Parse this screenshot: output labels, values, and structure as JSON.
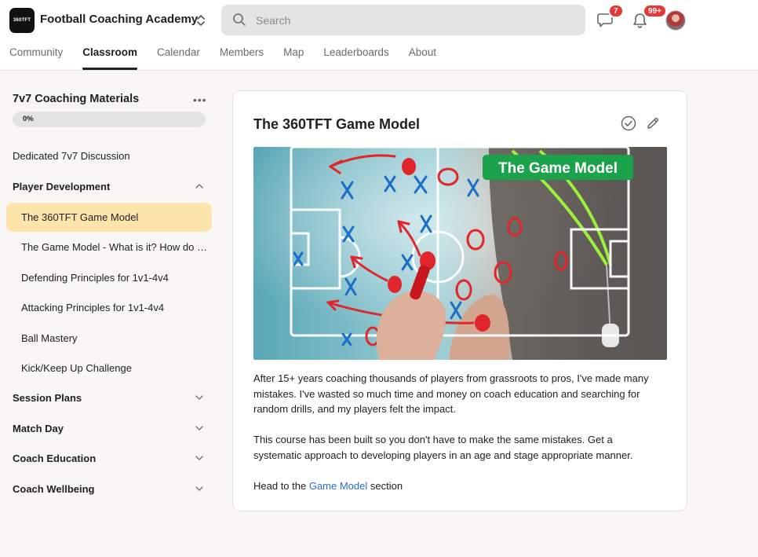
{
  "header": {
    "logo_text": "360TFT",
    "site_name": "Football Coaching Academy",
    "search_placeholder": "Search",
    "chat_badge": "7",
    "notifications_badge": "99+"
  },
  "nav": {
    "tabs": [
      {
        "label": "Community"
      },
      {
        "label": "Classroom"
      },
      {
        "label": "Calendar"
      },
      {
        "label": "Members"
      },
      {
        "label": "Map"
      },
      {
        "label": "Leaderboards"
      },
      {
        "label": "About"
      }
    ],
    "active": "Classroom"
  },
  "sidebar": {
    "course_title": "7v7 Coaching Materials",
    "more_label": "•••",
    "progress_text": "0%",
    "progress_value": 0,
    "items": [
      {
        "label": "Dedicated 7v7 Discussion"
      },
      {
        "label": "Player Development"
      },
      {
        "label": "The 360TFT Game Model"
      },
      {
        "label": "The Game Model - What is it? How do we use it?"
      },
      {
        "label": "Defending Principles for 1v1-4v4"
      },
      {
        "label": "Attacking Principles for 1v1-4v4"
      },
      {
        "label": "Ball Mastery"
      },
      {
        "label": "Kick/Keep Up Challenge"
      },
      {
        "label": "Session Plans"
      },
      {
        "label": "Match Day"
      },
      {
        "label": "Coach Education"
      },
      {
        "label": "Coach Wellbeing"
      }
    ]
  },
  "lesson": {
    "title": "The 360TFT Game Model",
    "image_banner": "The Game Model",
    "paragraph1": "After 15+ years coaching thousands of players from grassroots to pros, I've made many mistakes. I've wasted so much time and money on coach education and searching for random drills, and my players felt the impact.",
    "paragraph2": "This course has been built so you don't have to make the same mistakes. Get a systematic approach to developing players in an age and stage appropriate manner.",
    "p3_prefix": "Head to the ",
    "p3_link": "Game Model",
    "p3_suffix": " section"
  },
  "colors": {
    "accent_active": "#fde4aa",
    "badge": "#e53935",
    "link": "#2f6bd6",
    "banner_green": "#1aa34a"
  }
}
